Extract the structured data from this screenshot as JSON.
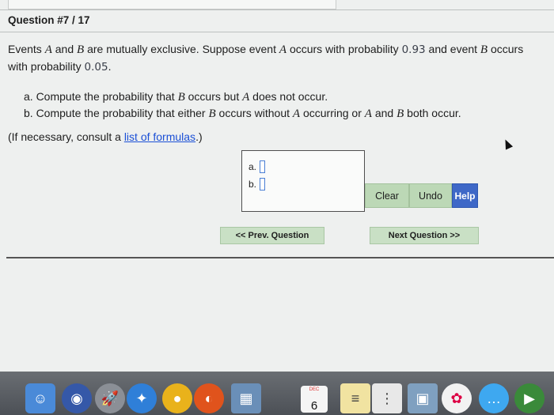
{
  "question": {
    "title": "Question #7 / 17",
    "prompt": {
      "s1": "Events ",
      "ev_a": "A",
      "s2": " and ",
      "ev_b": "B",
      "s3": " are mutually exclusive. Suppose event ",
      "ev_a2": "A",
      "s4": " occurs with probability ",
      "p_a": "0.93",
      "s5": " and event ",
      "ev_b2": "B",
      "s6": " occurs with probability ",
      "p_b": "0.05",
      "s7": "."
    },
    "part_a": {
      "prefix": "a. Compute the probability that ",
      "v1": "B",
      "mid": " occurs but ",
      "v2": "A",
      "suffix": " does not occur."
    },
    "part_b": {
      "prefix": "b. Compute the probability that either ",
      "v1": "B",
      "m1": " occurs without ",
      "v2": "A",
      "m2": " occurring or ",
      "v3": "A",
      "m3": " and ",
      "v4": "B",
      "suffix": " both occur."
    },
    "note_prefix": "(If necessary, consult a ",
    "note_link": "list of formulas",
    "note_suffix": ".)"
  },
  "answers": {
    "a_label": "a.",
    "b_label": "b.",
    "a_value": "",
    "b_value": ""
  },
  "buttons": {
    "clear": "Clear",
    "undo": "Undo",
    "help": "Help",
    "prev": "<< Prev. Question",
    "next": "Next Question >>"
  },
  "dock": {
    "calendar_month": "DEC",
    "calendar_day": "6"
  },
  "colors": {
    "button_green": "#bcd8b6",
    "help_blue": "#3e68c7",
    "link_blue": "#1a4fd6"
  }
}
